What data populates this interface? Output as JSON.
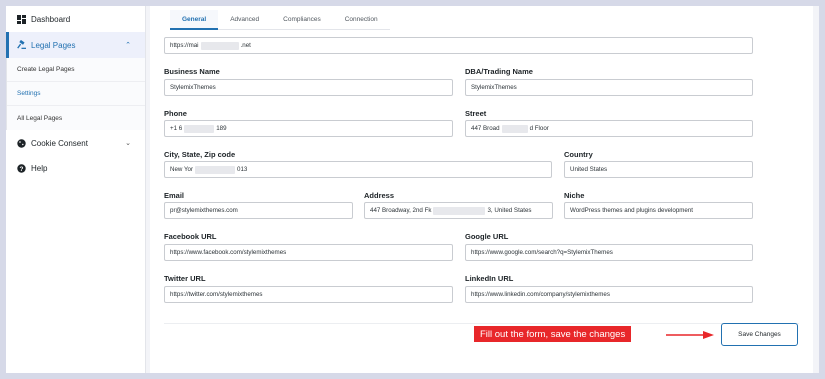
{
  "sidebar": {
    "items": [
      {
        "label": "Dashboard",
        "icon": "dashboard-icon"
      },
      {
        "label": "Legal Pages",
        "icon": "gavel-icon"
      },
      {
        "label": "Cookie Consent",
        "icon": "cookie-icon"
      },
      {
        "label": "Help",
        "icon": "help-icon"
      }
    ],
    "sub_items": [
      {
        "label": "Create Legal Pages"
      },
      {
        "label": "Settings"
      },
      {
        "label": "All Legal Pages"
      }
    ]
  },
  "tabs": [
    "General",
    "Advanced",
    "Compliances",
    "Connection"
  ],
  "form": {
    "url": {
      "value_a": "https://mai",
      "value_b": ".net"
    },
    "business_name": {
      "label": "Business Name",
      "value": "StylemixThemes"
    },
    "dba": {
      "label": "DBA/Trading Name",
      "value": "StylemixThemes"
    },
    "phone": {
      "label": "Phone",
      "value_a": "+1 6",
      "value_b": "189"
    },
    "street": {
      "label": "Street",
      "value_a": "447 Broad",
      "value_b": "d Floor"
    },
    "city": {
      "label": "City, State, Zip code",
      "value_a": "New Yor",
      "value_b": "013"
    },
    "country": {
      "label": "Country",
      "value": "United States"
    },
    "email": {
      "label": "Email",
      "value": "pr@stylemixthemes.com"
    },
    "address": {
      "label": "Address",
      "value_a": "447 Broadway, 2nd Fk",
      "value_b": "3, United States"
    },
    "niche": {
      "label": "Niche",
      "value": "WordPress themes and plugins development"
    },
    "facebook": {
      "label": "Facebook URL",
      "value": "https://www.facebook.com/stylemixthemes"
    },
    "google": {
      "label": "Google URL",
      "value": "https://www.google.com/search?q=StylemixThemes"
    },
    "twitter": {
      "label": "Twitter URL",
      "value": "https://twitter.com/stylemixthemes"
    },
    "linkedin": {
      "label": "LinkedIn URL",
      "value": "https://www.linkedin.com/company/stylemixthemes"
    }
  },
  "save_label": "Save Changes",
  "annotation": "Fill out the form, save the changes",
  "colors": {
    "accent": "#2271b1",
    "callout": "#e8272a"
  }
}
